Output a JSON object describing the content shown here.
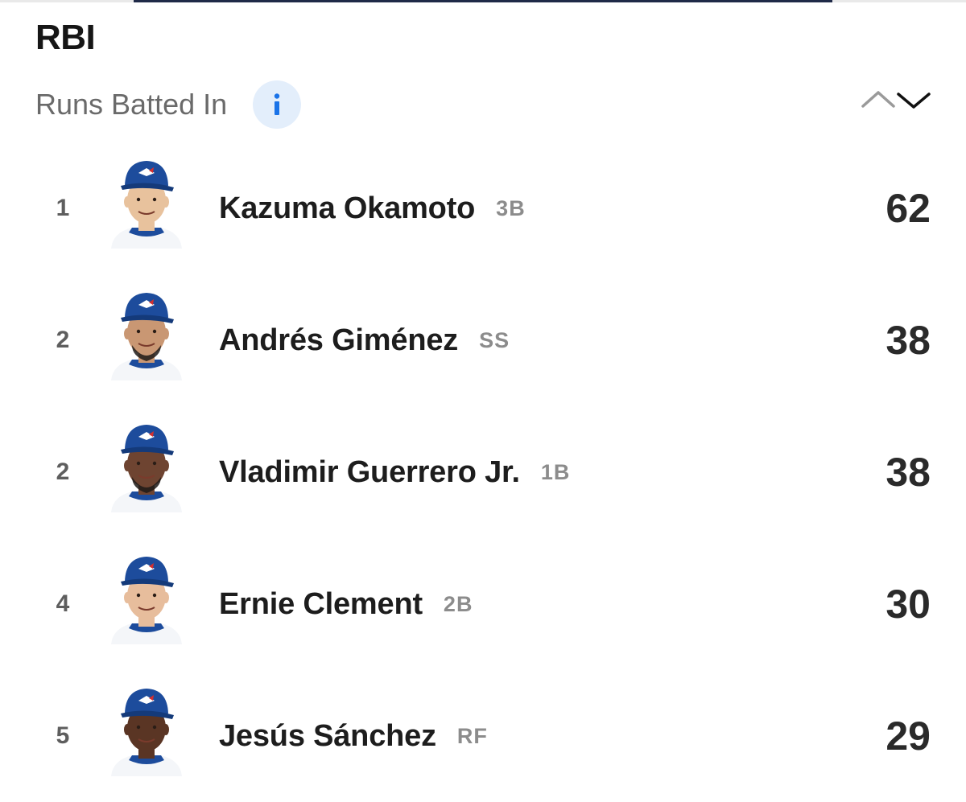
{
  "header": {
    "title": "RBI",
    "subtitle": "Runs Batted In",
    "info_icon": "info-icon",
    "sort_icons": [
      "chevron-up-icon",
      "chevron-down-icon"
    ]
  },
  "colors": {
    "cap_blue": "#1d4c9c",
    "info_bg": "#e3eefb",
    "info_glyph": "#1a73e8"
  },
  "leaders": [
    {
      "rank": "1",
      "name": "Kazuma Okamoto",
      "position": "3B",
      "value": "62",
      "skin": "#e8c29d",
      "beard": false
    },
    {
      "rank": "2",
      "name": "Andrés Giménez",
      "position": "SS",
      "value": "38",
      "skin": "#c99773",
      "beard": true
    },
    {
      "rank": "2",
      "name": "Vladimir Guerrero Jr.",
      "position": "1B",
      "value": "38",
      "skin": "#6e4431",
      "beard": true
    },
    {
      "rank": "4",
      "name": "Ernie Clement",
      "position": "2B",
      "value": "30",
      "skin": "#e7bd9c",
      "beard": false
    },
    {
      "rank": "5",
      "name": "Jesús Sánchez",
      "position": "RF",
      "value": "29",
      "skin": "#5a3524",
      "beard": false
    }
  ]
}
